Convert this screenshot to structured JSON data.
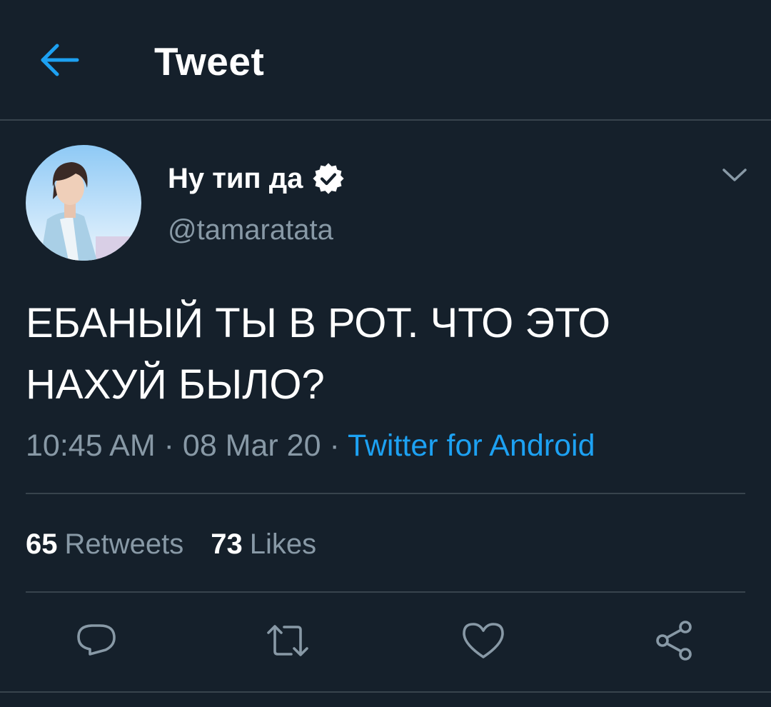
{
  "header": {
    "title": "Tweet"
  },
  "author": {
    "display_name": "Ну тип да",
    "handle": "@tamaratata",
    "verified": true
  },
  "tweet": {
    "text": "ЕБАНЫЙ ТЫ В РОТ. ЧТО ЭТО\nНАХУЙ БЫЛО?",
    "time": "10:45 AM",
    "separator": " · ",
    "date": "08 Mar 20",
    "source": "Twitter for Android"
  },
  "stats": {
    "retweets_count": "65",
    "retweets_label": "Retweets",
    "likes_count": "73",
    "likes_label": "Likes"
  },
  "colors": {
    "background": "#15202b",
    "accent": "#1da1f2",
    "secondary_text": "#8899a6",
    "divider": "#38444d"
  },
  "icons": {
    "back": "arrow-left-icon",
    "verified": "verified-badge-icon",
    "more": "chevron-down-icon",
    "reply": "reply-icon",
    "retweet": "retweet-icon",
    "like": "heart-icon",
    "share": "share-icon"
  }
}
